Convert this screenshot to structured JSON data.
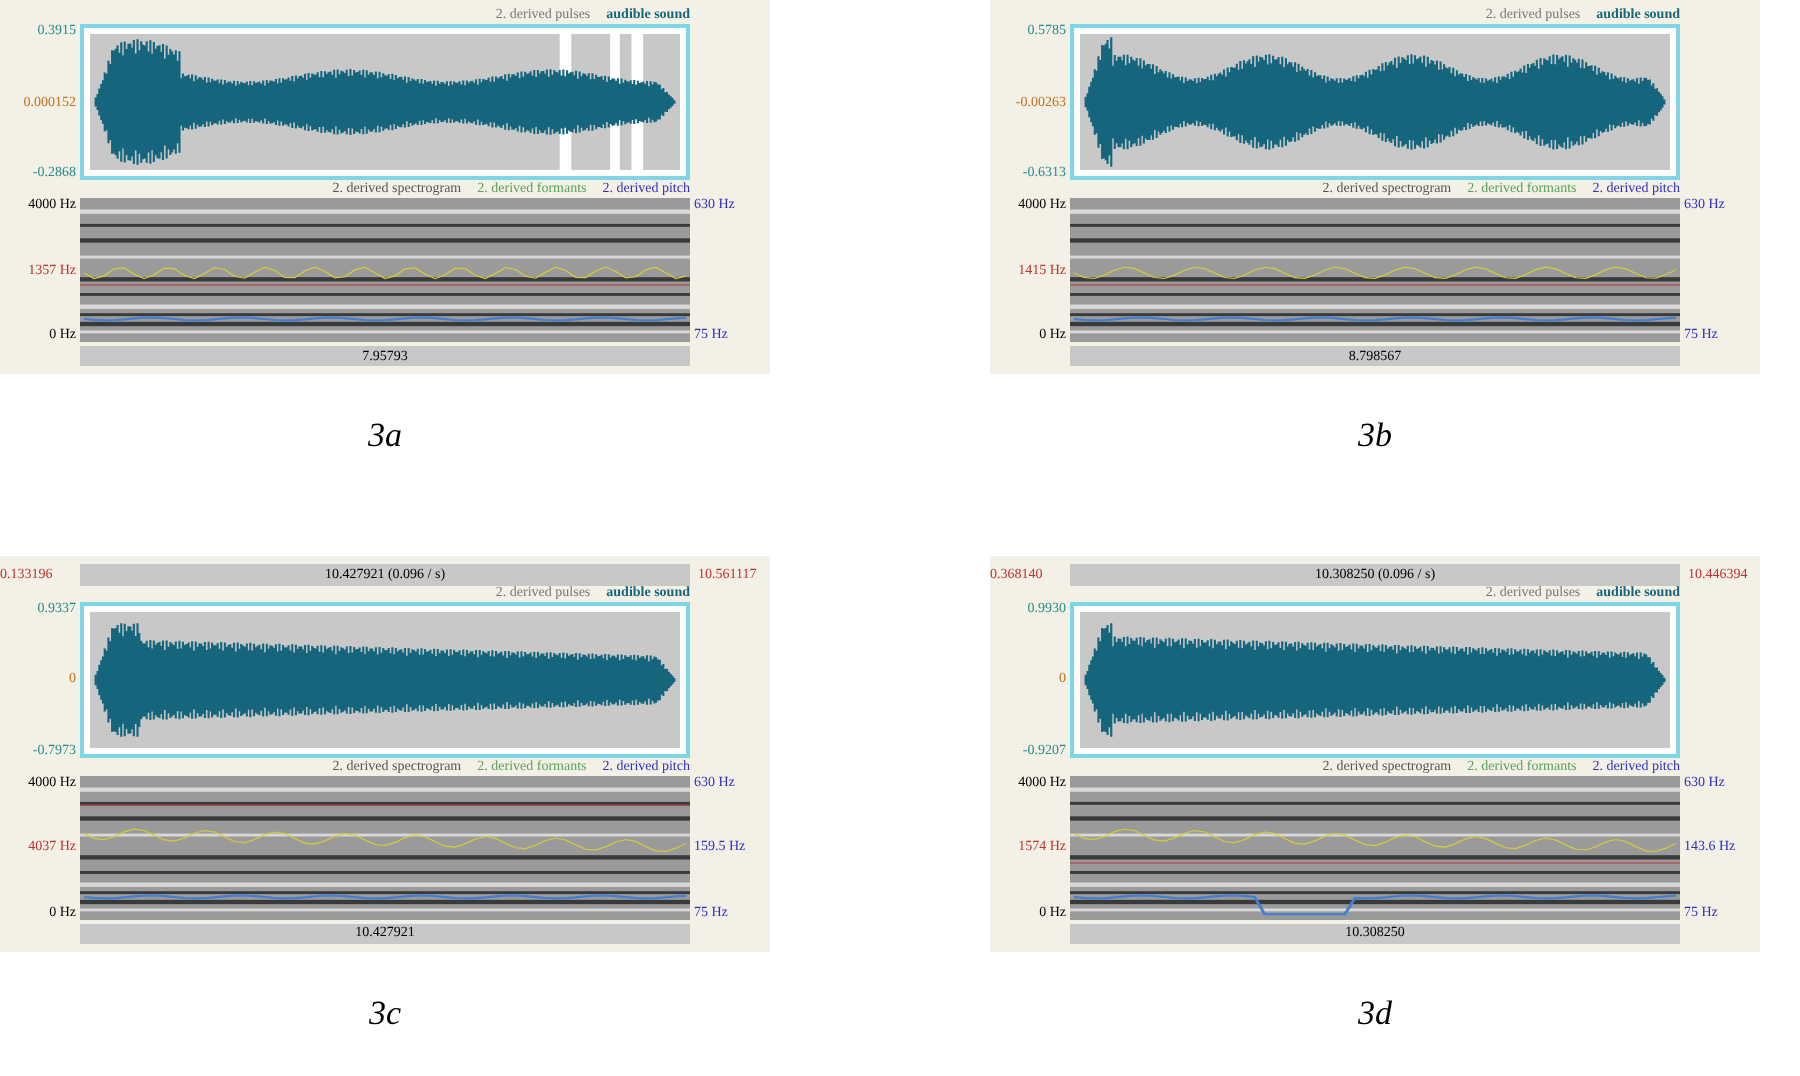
{
  "panels": [
    {
      "caption": "3a",
      "wave_max": "0.3915",
      "wave_mid": "0.000152",
      "wave_min": "-0.2868",
      "wave_legend": [
        "2. derived pulses",
        "audible sound"
      ],
      "spec_legend": [
        "2. derived spectrogram",
        "2. derived formants",
        "2. derived pitch"
      ],
      "freq_max": "4000 Hz",
      "freq_mark": "1357 Hz",
      "freq_min": "0 Hz",
      "pitch_max": "630 Hz",
      "pitch_min": "75 Hz",
      "bottom_bar": "7.95793"
    },
    {
      "caption": "3b",
      "wave_max": "0.5785",
      "wave_mid": "-0.00263",
      "wave_min": "-0.6313",
      "wave_legend": [
        "2. derived pulses",
        "audible sound"
      ],
      "spec_legend": [
        "2. derived spectrogram",
        "2. derived formants",
        "2. derived pitch"
      ],
      "freq_max": "4000 Hz",
      "freq_mark": "1415 Hz",
      "freq_min": "0 Hz",
      "pitch_max": "630 Hz",
      "pitch_min": "75 Hz",
      "bottom_bar": "8.798567"
    },
    {
      "caption": "3c",
      "top_bar": "10.427921 (0.096 / s)",
      "time_start": "0.133196",
      "time_end": "10.561117",
      "wave_max": "0.9337",
      "wave_mid": "0",
      "wave_min": "-0.7973",
      "wave_legend": [
        "2. derived pulses",
        "audible sound"
      ],
      "spec_legend": [
        "2. derived spectrogram",
        "2. derived formants",
        "2. derived pitch"
      ],
      "freq_max": "4000 Hz",
      "freq_mark": "4037 Hz",
      "freq_min": "0 Hz",
      "pitch_max": "630 Hz",
      "pitch_mark": "159.5 Hz",
      "pitch_min": "75 Hz",
      "bottom_bar": "10.427921"
    },
    {
      "caption": "3d",
      "top_bar": "10.308250 (0.096 / s)",
      "time_start": "0.368140",
      "time_end": "10.446394",
      "wave_max": "0.9930",
      "wave_mid": "0",
      "wave_min": "-0.9207",
      "wave_legend": [
        "2. derived pulses",
        "audible sound"
      ],
      "spec_legend": [
        "2. derived spectrogram",
        "2. derived formants",
        "2. derived pitch"
      ],
      "freq_max": "4000 Hz",
      "freq_mark": "1574 Hz",
      "freq_min": "0 Hz",
      "pitch_max": "630 Hz",
      "pitch_mark": "143.6 Hz",
      "pitch_min": "75 Hz",
      "bottom_bar": "10.308250"
    }
  ]
}
